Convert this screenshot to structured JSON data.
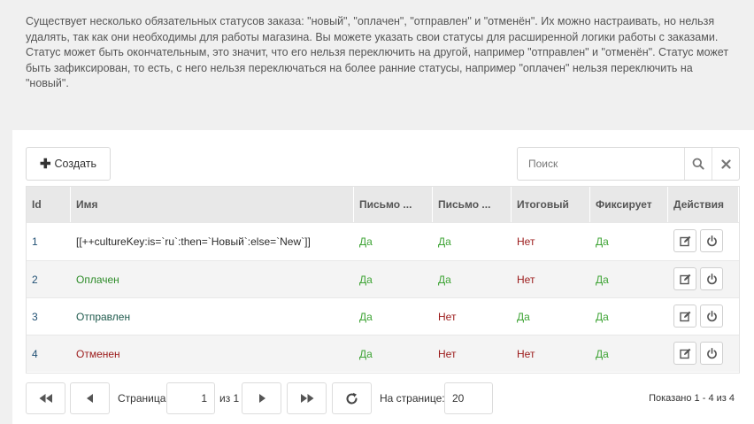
{
  "info": {
    "paragraph1": "Существует несколько обязательных статусов заказа: \"новый\", \"оплачен\", \"отправлен\" и \"отменён\". Их можно настраивать, но нельзя удалять, так как они необходимы для работы магазина. Вы можете указать свои статусы для расширенной логики работы с заказами.",
    "paragraph2": "Статус может быть окончательным, это значит, что его нельзя переключить на другой, например \"отправлен\" и \"отменён\". Статус может быть зафиксирован, то есть, с него нельзя переключаться на более ранние статусы, например \"оплачен\" нельзя переключить на \"новый\"."
  },
  "toolbar": {
    "create_label": "Создать",
    "create_icon": "plus-icon",
    "search_placeholder": "Поиск",
    "search_icon": "search-icon",
    "clear_icon": "close-icon"
  },
  "grid": {
    "columns": [
      "Id",
      "Имя",
      "Письмо ...",
      "Письмо ...",
      "Итоговый",
      "Фиксирует",
      "Действия"
    ],
    "rows": [
      {
        "id": "1",
        "name": "[[++cultureKey:is=`ru`:then=`Новый`:else=`New`]]",
        "mail1": "Да",
        "mail2": "Да",
        "final": "Нет",
        "fixes": "Да"
      },
      {
        "id": "2",
        "name": "Оплачен",
        "mail1": "Да",
        "mail2": "Да",
        "final": "Нет",
        "fixes": "Да"
      },
      {
        "id": "3",
        "name": "Отправлен",
        "mail1": "Да",
        "mail2": "Нет",
        "final": "Да",
        "fixes": "Да"
      },
      {
        "id": "4",
        "name": "Отменен",
        "mail1": "Да",
        "mail2": "Нет",
        "final": "Нет",
        "fixes": "Да"
      }
    ],
    "action_icons": [
      "edit-icon",
      "power-icon"
    ]
  },
  "pager": {
    "page_label": "Страница",
    "page_value": "1",
    "of_label": "из 1",
    "per_page_label": "На странице:",
    "per_page_value": "20",
    "shown_text": "Показано 1 - 4 из 4"
  },
  "colors": {
    "yes": "#3fa436",
    "no": "#9b1a1a",
    "header_bg": "#e8e8e8",
    "info_bg": "#f0f0f0"
  }
}
